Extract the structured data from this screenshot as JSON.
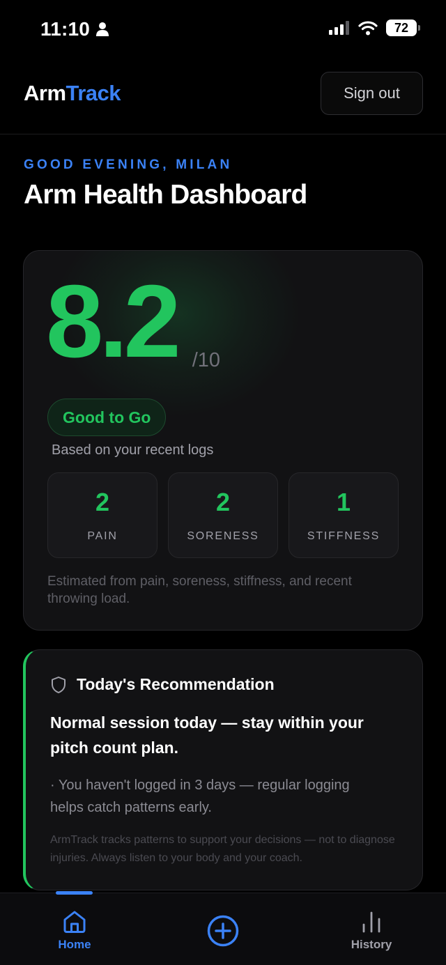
{
  "status_bar": {
    "time": "11:10",
    "battery": "72"
  },
  "header": {
    "logo_part1": "Arm",
    "logo_part2": "Track",
    "sign_out_label": "Sign out"
  },
  "greeting": "GOOD EVENING, MILAN",
  "page_title": "Arm Health Dashboard",
  "score_card": {
    "score": "8.2",
    "score_max": "/10",
    "status": "Good to Go",
    "based_on": "Based on your recent logs",
    "metrics": [
      {
        "value": "2",
        "label": "PAIN"
      },
      {
        "value": "2",
        "label": "SORENESS"
      },
      {
        "value": "1",
        "label": "STIFFNESS"
      }
    ],
    "note": "Estimated from pain, soreness, stiffness, and recent throwing load."
  },
  "recommendation": {
    "title": "Today's Recommendation",
    "main": "Normal session today — stay within your pitch count plan.",
    "note": "· You haven't logged in 3 days — regular logging helps catch patterns early.",
    "disclaimer": "ArmTrack tracks patterns to support your decisions — not to diagnose injuries. Always listen to your body and your coach."
  },
  "bottom_nav": {
    "home_label": "Home",
    "history_label": "History"
  },
  "colors": {
    "accent_blue": "#3b82f6",
    "accent_green": "#22c55e",
    "background": "#000000",
    "card": "#121214"
  },
  "icons": {
    "shield": "shield-icon",
    "home": "home-icon",
    "add": "plus-circle-icon",
    "history": "bar-chart-icon"
  }
}
